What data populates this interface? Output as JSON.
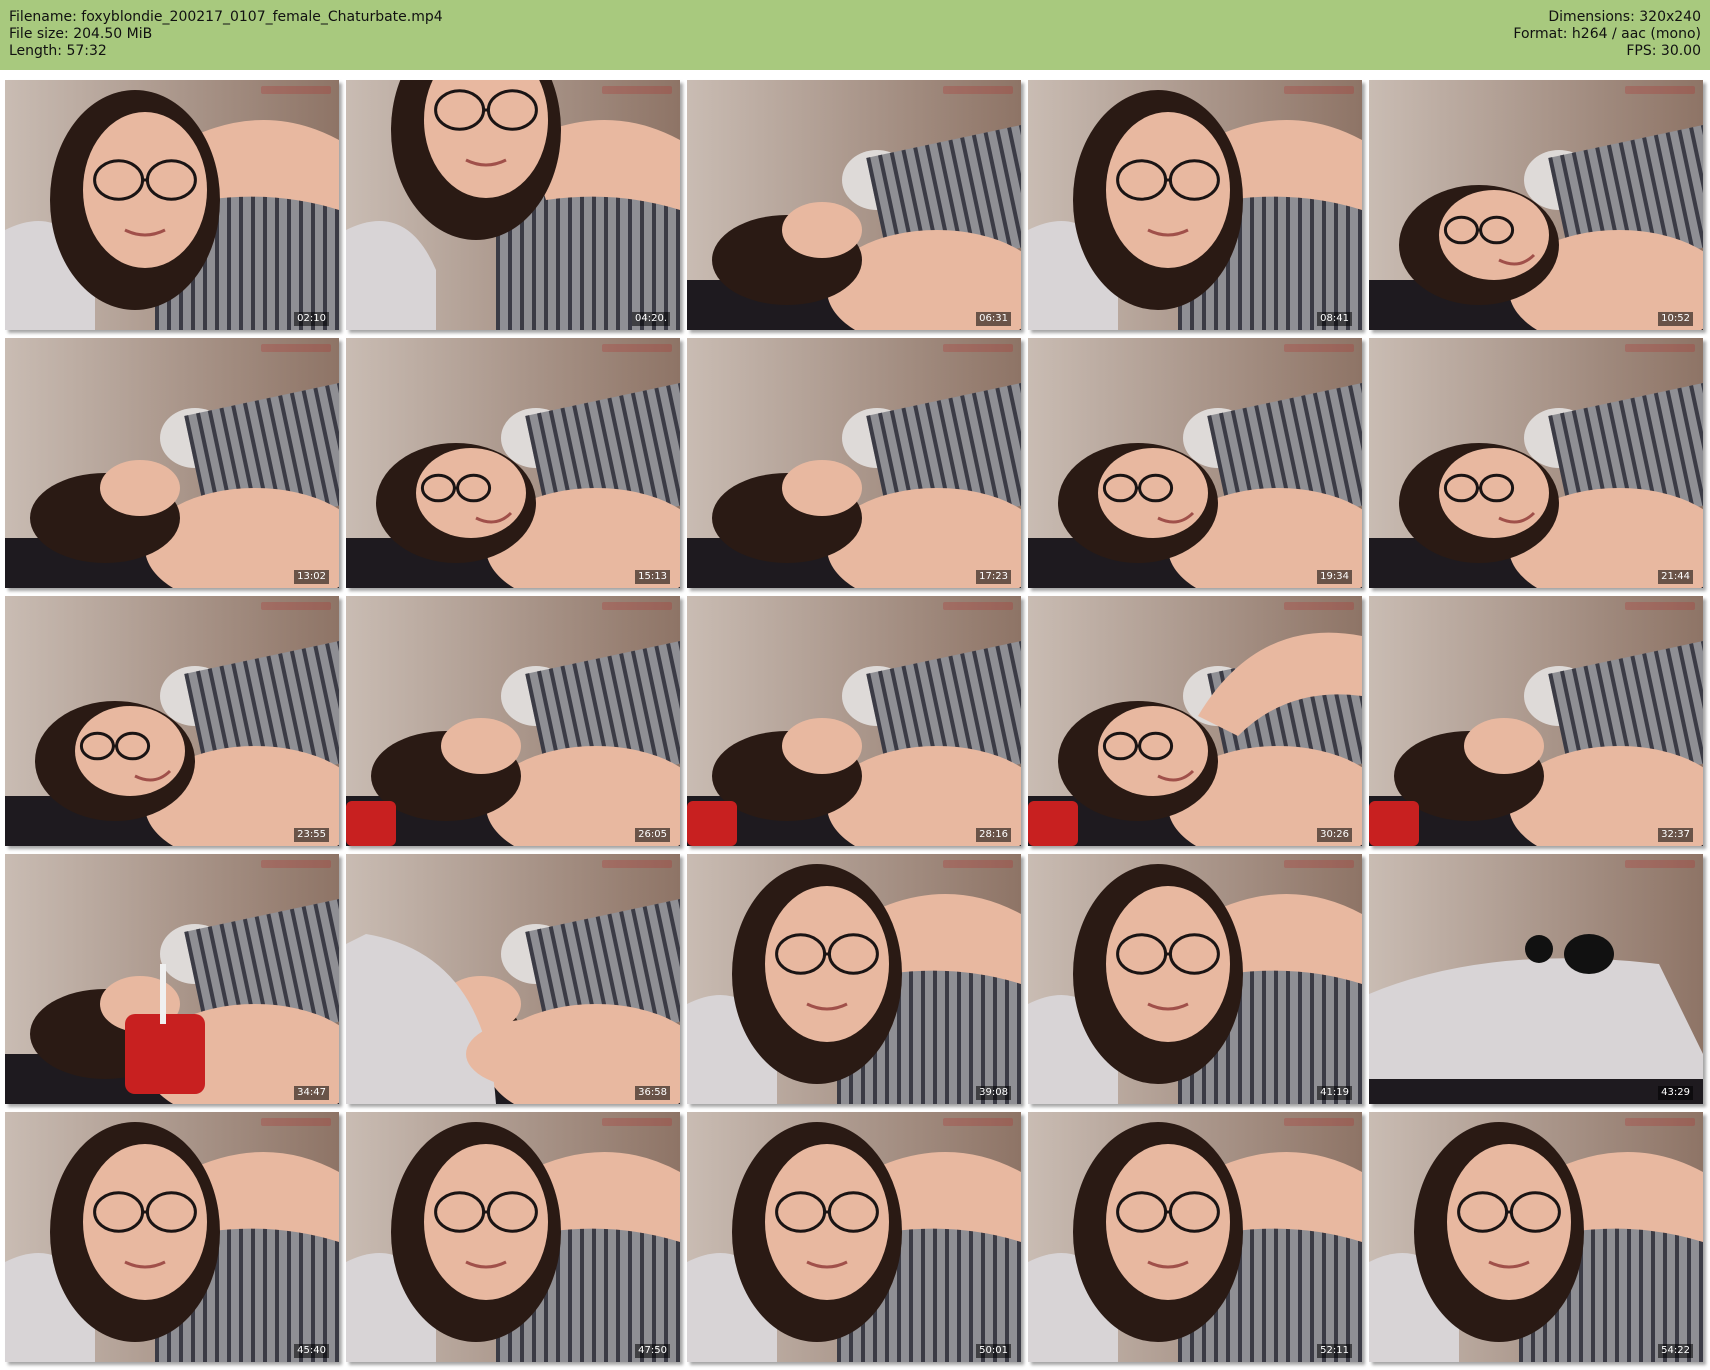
{
  "header": {
    "filename": "Filename: foxyblondie_200217_0107_female_Chaturbate.mp4",
    "filesize": "File size: 204.50 MiB",
    "length": "Length: 57:32",
    "dimensions": "Dimensions: 320x240",
    "format": "Format: h264 / aac (mono)",
    "fps": "FPS: 30.00"
  },
  "colors": {
    "header_bg": "#a8c97e",
    "wall": "#a59080",
    "skin": "#e8b8a0",
    "hair": "#2a1a14",
    "stripe_a": "#8f8f94",
    "stripe_b": "#3b3b45",
    "bedding": "#d8d4d6",
    "dark_sheet": "#1e1a1f",
    "cup_red": "#c82020"
  },
  "thumbnails": [
    {
      "time": "02:10",
      "scene": "face-close"
    },
    {
      "time": "04:20.",
      "scene": "face-top"
    },
    {
      "time": "06:31",
      "scene": "lying-back"
    },
    {
      "time": "08:41",
      "scene": "face-close"
    },
    {
      "time": "10:52",
      "scene": "lying-smile"
    },
    {
      "time": "13:02",
      "scene": "lying-back"
    },
    {
      "time": "15:13",
      "scene": "lying-smile"
    },
    {
      "time": "17:23",
      "scene": "lying-back"
    },
    {
      "time": "19:34",
      "scene": "lying-smile"
    },
    {
      "time": "21:44",
      "scene": "lying-smile"
    },
    {
      "time": "23:55",
      "scene": "lying-smile"
    },
    {
      "time": "26:05",
      "scene": "lying-back-cup"
    },
    {
      "time": "28:16",
      "scene": "lying-back-cup"
    },
    {
      "time": "30:26",
      "scene": "lying-arm"
    },
    {
      "time": "32:37",
      "scene": "lying-back-cup"
    },
    {
      "time": "34:47",
      "scene": "drink-cup"
    },
    {
      "time": "36:58",
      "scene": "pillow-hold"
    },
    {
      "time": "39:08",
      "scene": "face-close"
    },
    {
      "time": "41:19",
      "scene": "face-close"
    },
    {
      "time": "43:29",
      "scene": "pillow-only"
    },
    {
      "time": "45:40",
      "scene": "face-close"
    },
    {
      "time": "47:50",
      "scene": "face-close"
    },
    {
      "time": "50:01",
      "scene": "face-close"
    },
    {
      "time": "52:11",
      "scene": "face-close"
    },
    {
      "time": "54:22",
      "scene": "face-close"
    }
  ]
}
